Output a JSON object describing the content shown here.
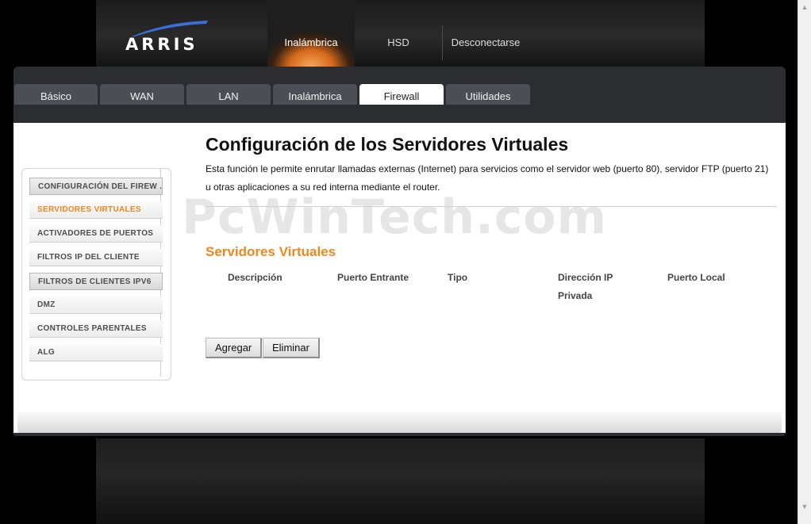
{
  "brand": {
    "name": "ARRIS",
    "color": "#ffffff"
  },
  "top_nav": {
    "items": [
      "Inalámbrica",
      "HSD",
      "Desconectarse"
    ],
    "active": "Inalámbrica"
  },
  "tabs": {
    "items": [
      "Básico",
      "WAN",
      "LAN",
      "Inalámbrica",
      "Firewall",
      "Utilidades"
    ],
    "active": "Firewall"
  },
  "sidebar": {
    "items": [
      "CONFIGURACIÓN DEL FIREW ...",
      "SERVIDORES VIRTUALES",
      "ACTIVADORES DE PUERTOS",
      "FILTROS IP DEL CLIENTE",
      "FILTROS DE CLIENTES IPV6",
      "DMZ",
      "CONTROLES PARENTALES",
      "ALG"
    ],
    "active": "SERVIDORES VIRTUALES"
  },
  "main": {
    "title": "Configuración de los Servidores Virtuales",
    "description": "Esta función le permite enrutar llamadas externas (Internet) para servicios como el servidor web (puerto 80), servidor FTP (puerto 21) u otras aplicaciones a su red interna mediante el router.",
    "section_title": "Servidores Virtuales",
    "table_headers": [
      "Descripción",
      "Puerto Entrante",
      "Tipo",
      "Dirección IP Privada",
      "Puerto Local"
    ],
    "buttons": {
      "add": "Agregar",
      "delete": "Eliminar"
    }
  },
  "watermark": "PcWinTech.com",
  "colors": {
    "accent": "#f0861e",
    "panel": "#2b2d30",
    "tab": "#4b4f55"
  },
  "scrollbar": {
    "up_icon": "▲",
    "down_icon": "▼"
  }
}
